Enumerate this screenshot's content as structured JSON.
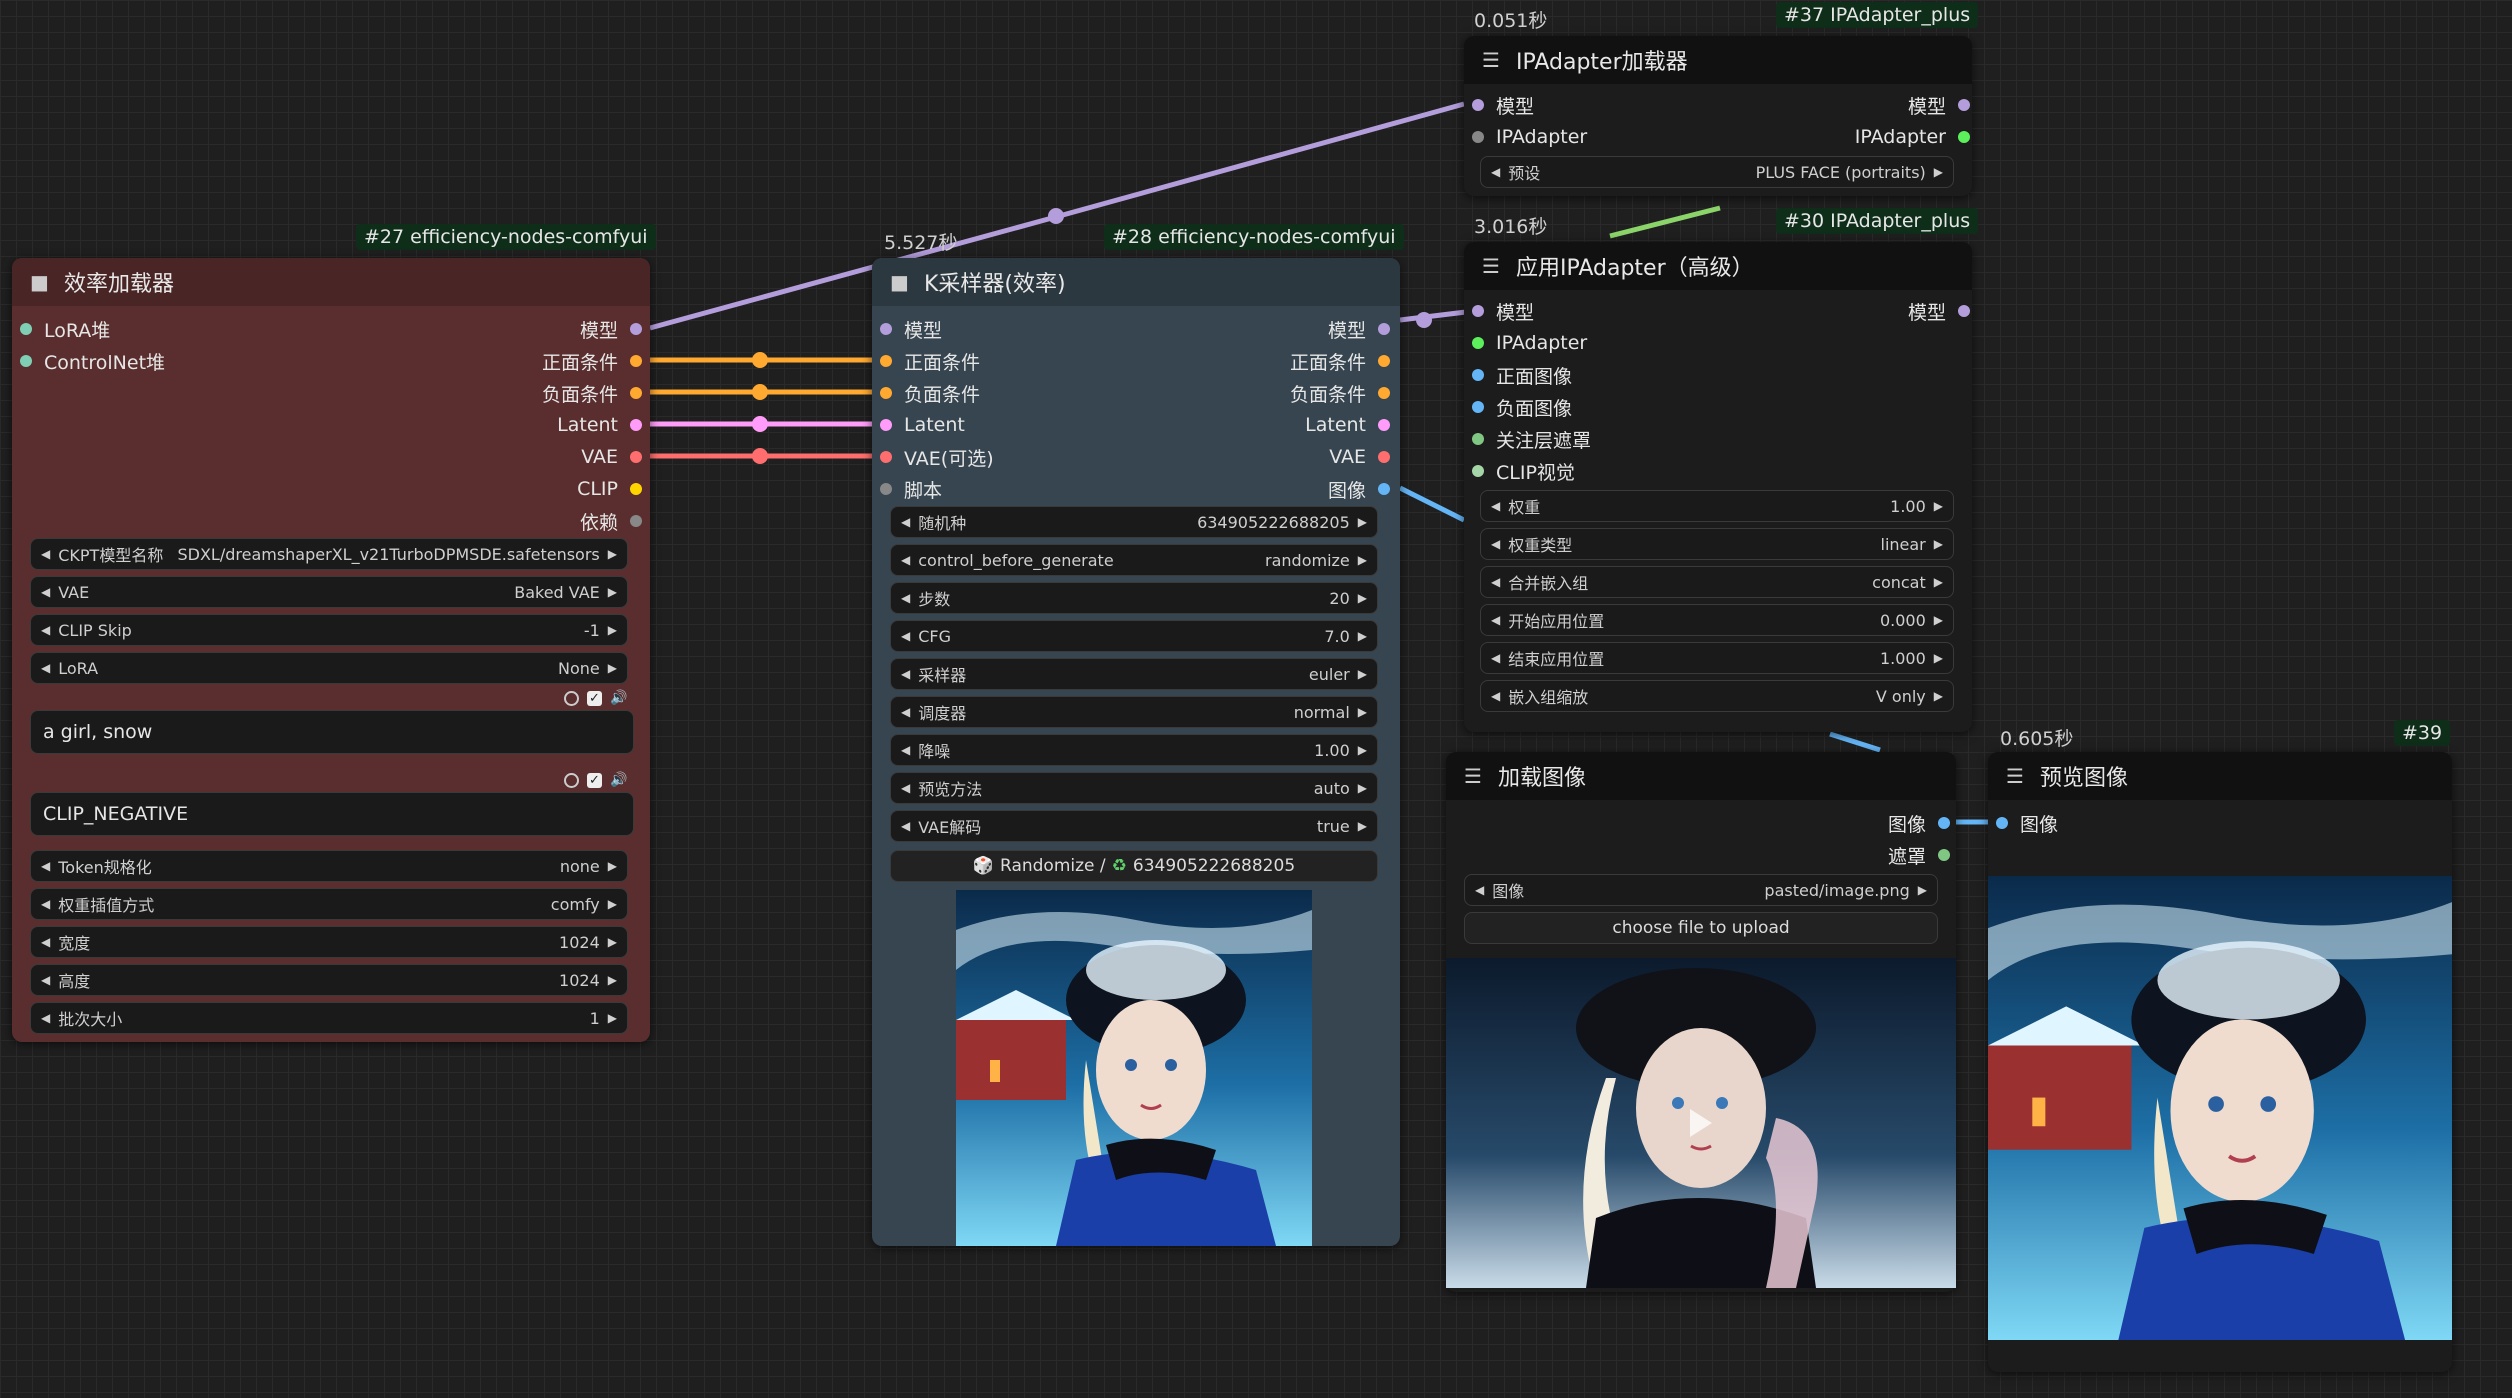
{
  "colors": {
    "model": "#b39ddb",
    "conditioning": "#ffa931",
    "latent": "#ff9cf9",
    "vae": "#ff6e6e",
    "clip": "#ffd500",
    "mask": "#81c784",
    "image": "#64b5f6",
    "deps": "#888888",
    "green": "#8bd46a",
    "teal": "#7fcfb5"
  },
  "nodes": {
    "loader": {
      "badge": "#27 efficiency-nodes-comfyui",
      "title": "效率加载器",
      "inputs": [
        "LoRA堆",
        "ControlNet堆"
      ],
      "outputs": [
        "模型",
        "正面条件",
        "负面条件",
        "Latent",
        "VAE",
        "CLIP",
        "依赖"
      ],
      "widgets_top": [
        {
          "label": "CKPT模型名称",
          "value": "SDXL/dreamshaperXL_v21TurboDPMSDE.safetensors"
        },
        {
          "label": "VAE",
          "value": "Baked VAE"
        },
        {
          "label": "CLIP Skip",
          "value": "-1"
        },
        {
          "label": "LoRA",
          "value": "None"
        }
      ],
      "positive_text": "a girl, snow",
      "negative_text": "CLIP_NEGATIVE",
      "widgets_bottom": [
        {
          "label": "Token规格化",
          "value": "none"
        },
        {
          "label": "权重插值方式",
          "value": "comfy"
        },
        {
          "label": "宽度",
          "value": "1024"
        },
        {
          "label": "高度",
          "value": "1024"
        },
        {
          "label": "批次大小",
          "value": "1"
        }
      ]
    },
    "sampler": {
      "timing": "5.527秒",
      "badge": "#28 efficiency-nodes-comfyui",
      "title": "K采样器(效率)",
      "inputs": [
        "模型",
        "正面条件",
        "负面条件",
        "Latent",
        "VAE(可选)",
        "脚本"
      ],
      "outputs": [
        "模型",
        "正面条件",
        "负面条件",
        "Latent",
        "VAE",
        "图像"
      ],
      "widgets": [
        {
          "label": "随机种",
          "value": "634905222688205"
        },
        {
          "label": "control_before_generate",
          "value": "randomize"
        },
        {
          "label": "步数",
          "value": "20"
        },
        {
          "label": "CFG",
          "value": "7.0"
        },
        {
          "label": "采样器",
          "value": "euler"
        },
        {
          "label": "调度器",
          "value": "normal"
        },
        {
          "label": "降噪",
          "value": "1.00"
        },
        {
          "label": "预览方法",
          "value": "auto"
        },
        {
          "label": "VAE解码",
          "value": "true"
        }
      ],
      "randomize_label": "Randomize /",
      "randomize_seed": "634905222688205"
    },
    "ipa_loader": {
      "timing": "0.051秒",
      "badge": "#37 IPAdapter_plus",
      "title": "IPAdapter加载器",
      "inputs": [
        "模型",
        "IPAdapter"
      ],
      "outputs": [
        "模型",
        "IPAdapter"
      ],
      "widgets": [
        {
          "label": "预设",
          "value": "PLUS FACE (portraits)"
        }
      ]
    },
    "ipa_apply": {
      "timing": "3.016秒",
      "badge": "#30 IPAdapter_plus",
      "title": "应用IPAdapter（高级）",
      "inputs": [
        "模型",
        "IPAdapter",
        "正面图像",
        "负面图像",
        "关注层遮罩",
        "CLIP视觉"
      ],
      "outputs": [
        "模型"
      ],
      "widgets": [
        {
          "label": "权重",
          "value": "1.00"
        },
        {
          "label": "权重类型",
          "value": "linear"
        },
        {
          "label": "合并嵌入组",
          "value": "concat"
        },
        {
          "label": "开始应用位置",
          "value": "0.000"
        },
        {
          "label": "结束应用位置",
          "value": "1.000"
        },
        {
          "label": "嵌入组缩放",
          "value": "V only"
        }
      ]
    },
    "load_image": {
      "title": "加载图像",
      "outputs": [
        "图像",
        "遮罩"
      ],
      "widgets": [
        {
          "label": "图像",
          "value": "pasted/image.png"
        }
      ],
      "upload_label": "choose file to upload"
    },
    "preview": {
      "timing": "0.605秒",
      "badge": "#39",
      "title": "预览图像",
      "inputs": [
        "图像"
      ]
    }
  }
}
